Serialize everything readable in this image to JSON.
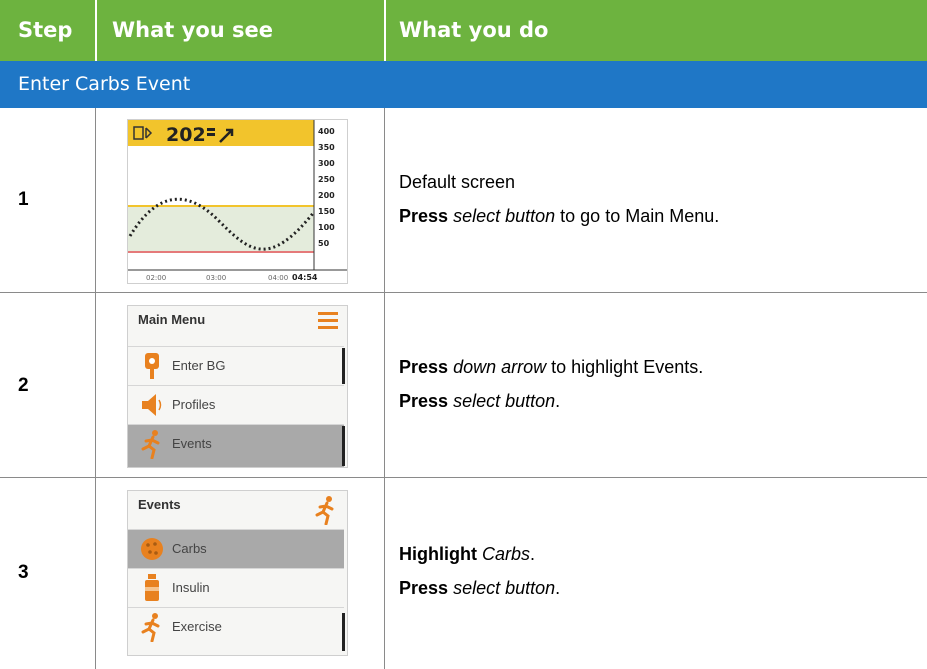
{
  "header": {
    "col_step": "Step",
    "col_see": "What you see",
    "col_do": "What you do",
    "bg_color": "#6db33f"
  },
  "section": {
    "title": "Enter Carbs Event",
    "bg_color": "#1f77c6"
  },
  "rows": [
    {
      "step": "1",
      "screen": {
        "glucose": "202",
        "y_ticks": [
          "400",
          "350",
          "300",
          "250",
          "200",
          "150",
          "100",
          "50"
        ],
        "x_ticks": [
          "02:00",
          "03:00",
          "04:00"
        ],
        "time": "04:54"
      },
      "instructions": {
        "line1": "Default screen",
        "line2_bold": "Press",
        "line2_italic": "select button",
        "line2_rest": "to go to Main Menu."
      }
    },
    {
      "step": "2",
      "screen": {
        "title": "Main Menu",
        "items": [
          "Enter BG",
          "Profiles",
          "Events"
        ]
      },
      "instructions": {
        "line1_bold": "Press",
        "line1_italic": "down arrow",
        "line1_rest": "to highlight Events.",
        "line2_bold": "Press",
        "line2_italic": "select button",
        "line2_rest": "."
      }
    },
    {
      "step": "3",
      "screen": {
        "title": "Events",
        "items": [
          "Carbs",
          "Insulin",
          "Exercise"
        ]
      },
      "instructions": {
        "line1_bold": "Highlight",
        "line1_italic": "Carbs",
        "line1_rest": ".",
        "line2_bold": "Press",
        "line2_italic": "select button",
        "line2_rest": "."
      }
    }
  ],
  "icons": {
    "bluetooth": "bluetooth-icon",
    "trend": "trend-arrow-icon",
    "menu": "hamburger-menu-icon",
    "blood_drop": "blood-drop-meter-icon",
    "speaker": "speaker-icon",
    "runner": "runner-icon",
    "carbs": "cookie-icon",
    "insulin": "insulin-vial-icon"
  },
  "accent_color": "#e8811f"
}
